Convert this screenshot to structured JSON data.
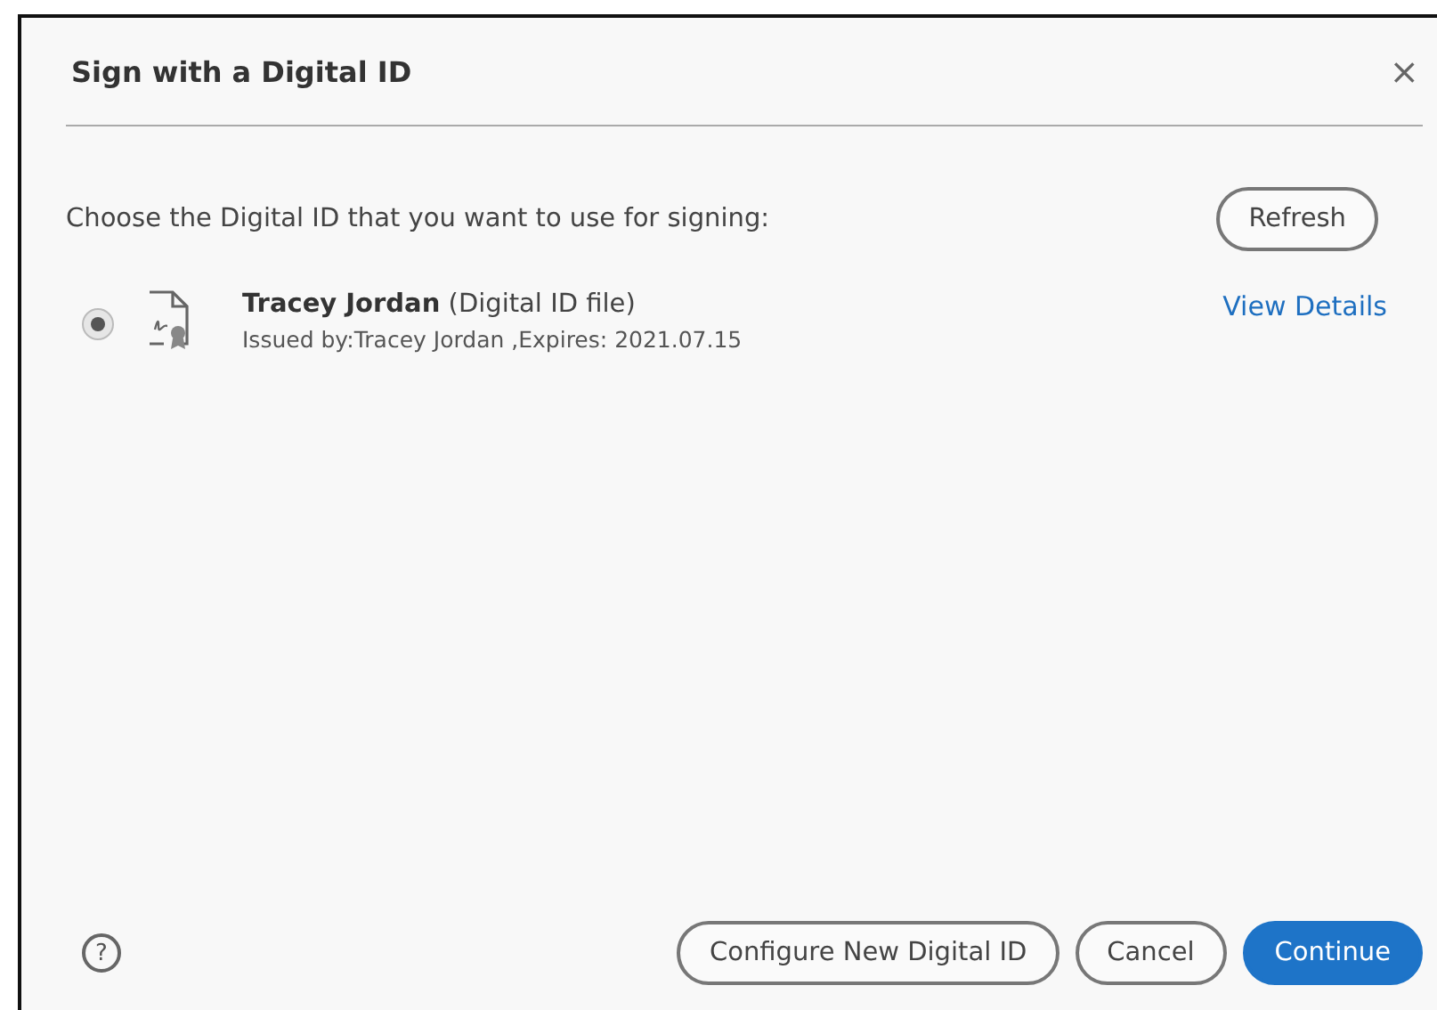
{
  "window": {
    "title": "Sign with a Digital ID",
    "close": "×"
  },
  "instruction": "Choose the Digital ID that you want to use for signing:",
  "refresh_button": "Refresh",
  "ids": [
    {
      "name": "Tracey Jordan",
      "type": "(Digital ID file)",
      "details": "Issued by:Tracey Jordan ,Expires: 2021.07.15",
      "link": "View Details",
      "selected": true
    }
  ],
  "help": "?",
  "buttons": [
    {
      "label": "Configure New Digital ID",
      "kind": "outline"
    },
    {
      "label": "Cancel",
      "kind": "outline"
    },
    {
      "label": "Continue",
      "kind": "primary"
    }
  ]
}
